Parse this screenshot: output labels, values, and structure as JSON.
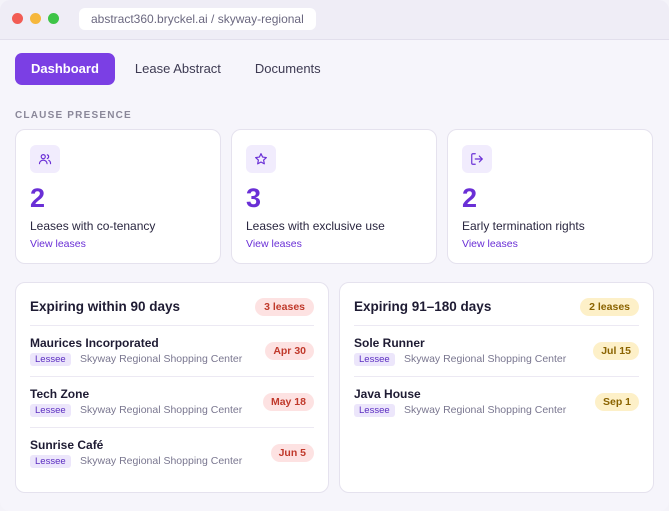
{
  "window": {
    "url": "abstract360.bryckel.ai / skyway-regional"
  },
  "tabs": [
    {
      "label": "Dashboard",
      "active": true
    },
    {
      "label": "Lease Abstract",
      "active": false
    },
    {
      "label": "Documents",
      "active": false
    }
  ],
  "clause_section": {
    "label": "CLAUSE PRESENCE"
  },
  "stats": [
    {
      "icon": "users-icon",
      "count": "2",
      "label": "Leases with co-tenancy",
      "link": "View leases"
    },
    {
      "icon": "star-icon",
      "count": "3",
      "label": "Leases with exclusive use",
      "link": "View leases"
    },
    {
      "icon": "exit-icon",
      "count": "2",
      "label": "Early termination rights",
      "link": "View leases"
    }
  ],
  "expiring_90": {
    "title": "Expiring within 90 days",
    "badge": "3 leases",
    "rows": [
      {
        "name": "Maurices Incorporated",
        "tag": "Lessee",
        "location": "Skyway Regional Shopping Center",
        "date": "Apr 30"
      },
      {
        "name": "Tech Zone",
        "tag": "Lessee",
        "location": "Skyway Regional Shopping Center",
        "date": "May 18"
      },
      {
        "name": "Sunrise Café",
        "tag": "Lessee",
        "location": "Skyway Regional Shopping Center",
        "date": "Jun 5"
      }
    ]
  },
  "expiring_180": {
    "title": "Expiring 91–180 days",
    "badge": "2 leases",
    "rows": [
      {
        "name": "Sole Runner",
        "tag": "Lessee",
        "location": "Skyway Regional Shopping Center",
        "date": "Jul 15"
      },
      {
        "name": "Java House",
        "tag": "Lessee",
        "location": "Skyway Regional Shopping Center",
        "date": "Sep 1"
      }
    ]
  },
  "colors": {
    "accent": "#7b3fe4",
    "danger_bg": "#fde2e2",
    "warning_bg": "#fdf0c8"
  }
}
